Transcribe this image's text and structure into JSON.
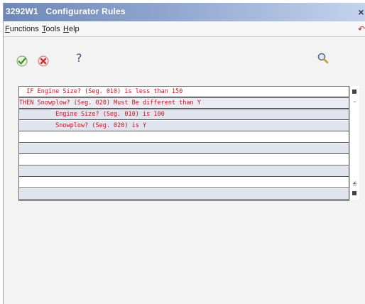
{
  "window": {
    "title": "3292W1   Configurator Rules",
    "close_glyph": "×"
  },
  "menu": {
    "items": [
      {
        "label": "Functions"
      },
      {
        "label": "Tools"
      },
      {
        "label": "Help"
      }
    ]
  },
  "toolbar": {
    "ok_icon": "check-icon",
    "cancel_icon": "cancel-icon",
    "help_glyph": "?",
    "search_icon": "magnifier-icon"
  },
  "rules": {
    "rows": [
      {
        "text": "  IF Engine Size? (Seg. 010) is less than 150",
        "style": "white"
      },
      {
        "text": "THEN Snowplow? (Seg. 020) Must Be different than Y",
        "style": "selected"
      },
      {
        "text": "          Engine Size? (Seg. 010) is 100",
        "style": "alt"
      },
      {
        "text": "          Snowplow? (Seg. 020) is Y",
        "style": "alt"
      },
      {
        "text": "",
        "style": "white"
      },
      {
        "text": "",
        "style": "blank"
      },
      {
        "text": "",
        "style": "white"
      },
      {
        "text": "",
        "style": "blank"
      },
      {
        "text": "",
        "style": "white"
      },
      {
        "text": "",
        "style": "blank"
      }
    ]
  },
  "colors": {
    "rule_text": "#c01818",
    "row_alt": "#dfe4ee",
    "title_gradient_start": "#6f88b6"
  }
}
